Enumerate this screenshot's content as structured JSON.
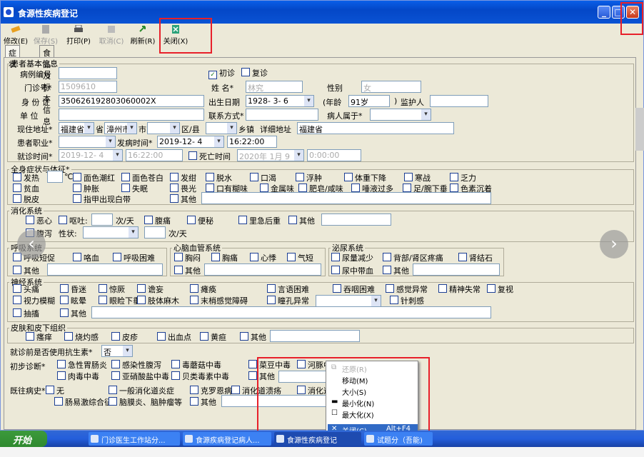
{
  "window": {
    "title": "食源性疾病登记"
  },
  "toolbar": {
    "modify": "修改(E)",
    "save": "保存(S)",
    "print": "打印(P)",
    "cancel": "取消(C)",
    "refresh": "刷新(R)",
    "close": "关闭(X)"
  },
  "tabs": [
    "症状",
    "食品及标本信息"
  ],
  "basic": {
    "legend": "患者基本信息",
    "first_visit": "初诊",
    "revisit": "复诊",
    "case_no_label": "病例编号",
    "case_no": "",
    "clinic_no_label": "门诊号*",
    "clinic_no": "1509610",
    "name_label": "姓  名*",
    "name": "林究",
    "sex_label": "性别",
    "sex": "女",
    "id_label": "身 份 证",
    "id": "350626192803060002X",
    "birth_label": "出生日期",
    "birth": "1928- 3- 6",
    "age_open": "(年龄",
    "age": "91岁",
    "age_close": ")",
    "guardian_label": "监护人",
    "guardian": "",
    "unit_label": "单    位",
    "unit": "",
    "contact_label": "联系方式*",
    "contact": "",
    "belongs_label": "病人属于*",
    "belongs": "",
    "addr_label": "现住地址*",
    "province": "福建省",
    "province_unit": "省",
    "city": "漳州市",
    "city_unit": "市",
    "district": "",
    "district_unit": "区/县",
    "town": "",
    "town_unit": "乡镇",
    "detail_label": "详细地址",
    "detail": "福建省",
    "job_label": "患者职业*",
    "job": "",
    "onset_label": "发病时间*",
    "onset_date": "2019-12- 4",
    "onset_time": "16:22:00",
    "visit_label": "就诊时间*",
    "visit_date": "2019-12- 4",
    "visit_time": "16:22:00",
    "death_label": "死亡时间",
    "death_date": "2020年 1月 9",
    "death_time": "0:00:00"
  },
  "general": {
    "legend": "全身症状与体征*",
    "fever": "发热",
    "temp_unit": "℃",
    "row1": [
      "面色潮红",
      "面色苍白",
      "发绀",
      "脱水",
      "口渴",
      "浮肿",
      "体重下降",
      "寒战",
      "乏力"
    ],
    "row2": [
      "贫血",
      "肿胀",
      "失眠",
      "畏光",
      "口有糊味",
      "金属味",
      "肥皂/咸味",
      "唾液过多",
      "足/腕下垂",
      "色素沉着"
    ],
    "row3": [
      "脱皮",
      "指甲出现白带",
      "其他"
    ]
  },
  "digest": {
    "legend": "消化系统",
    "nausea": "恶心",
    "vomit": "呕吐:",
    "vomit_unit": "次/天",
    "abd_pain": "腹痛",
    "constipation": "便秘",
    "tenesmus": "里急后重",
    "other": "其他",
    "diarrhea": "腹泻",
    "nature": "性状:",
    "diarrhea_unit": "次/天"
  },
  "resp": {
    "legend": "呼吸系统",
    "items": [
      "呼吸短促",
      "咯血",
      "呼吸困难"
    ],
    "other": "其他"
  },
  "cardio": {
    "legend": "心脑血管系统",
    "items": [
      "胸闷",
      "胸痛",
      "心悸",
      "气短"
    ],
    "other": "其他"
  },
  "uro": {
    "legend": "泌尿系统",
    "items": [
      "尿量减少",
      "背部/肾区疼痛",
      "肾结石",
      "尿中带血"
    ],
    "other": "其他"
  },
  "neuro": {
    "legend": "神经系统",
    "row1": [
      "头痛",
      "昏迷",
      "惊厥",
      "谵妄",
      "瘫痪",
      "言语困难",
      "吞咽困难",
      "感觉异常",
      "精神失常",
      "复视"
    ],
    "row2": [
      "视力模糊",
      "眩晕",
      "眼睑下垂",
      "肢体麻木",
      "末梢感觉障碍",
      "瞳孔异常"
    ],
    "row2b": "针刺感",
    "row3": [
      "抽搐",
      "其他"
    ]
  },
  "skin": {
    "legend": "皮肤和皮下组织",
    "items": [
      "瘙痒",
      "烧灼感",
      "皮疹",
      "出血点",
      "黄疸",
      "其他"
    ]
  },
  "antibiotic": {
    "label": "就诊前是否使用抗生素*",
    "value": "否"
  },
  "diagnosis": {
    "label": "初步诊断*",
    "row1": [
      "急性胃肠炎",
      "感染性腹泻",
      "毒蘑菇中毒",
      "菜豆中毒",
      "河豚中毒"
    ],
    "row2": [
      "肉毒中毒",
      "亚硝酸盐中毒",
      "贝类毒素中毒",
      "其他"
    ]
  },
  "history": {
    "label": "既往病史*",
    "row1": [
      "无",
      "一般消化道炎症",
      "克罗恩病",
      "消化道溃疡",
      "消化道"
    ],
    "row2": [
      "肠易激综合征",
      "脑膜炎、脑肿瘤等",
      "其他"
    ]
  },
  "context_menu": {
    "restore": "还原(R)",
    "move": "移动(M)",
    "size": "大小(S)",
    "minimize": "最小化(N)",
    "maximize": "最大化(X)",
    "close": "关闭(C)",
    "close_accel": "Alt+F4"
  },
  "taskbar": {
    "start": "开始",
    "tasks": [
      "门诊医生工作站分...",
      "食源疾病登记病人...",
      "食源性疾病登记",
      "试题分（吾能)"
    ]
  }
}
